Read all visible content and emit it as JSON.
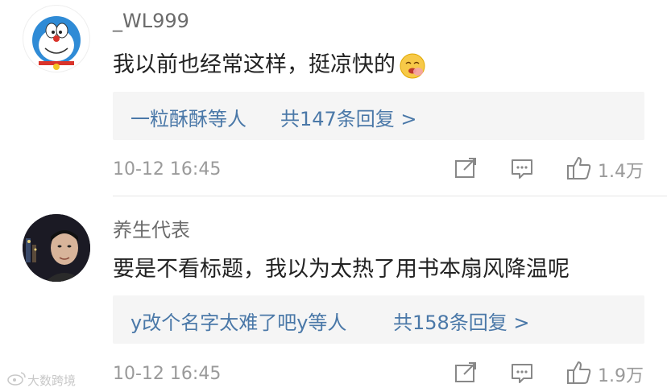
{
  "comments": [
    {
      "username": "_WL999",
      "text": "我以前也经常这样，挺凉快的",
      "reply_users": "一粒酥酥等人",
      "reply_count": "共147条回复 >",
      "time": "10-12 16:45",
      "likes": "1.4万"
    },
    {
      "username": "养生代表",
      "text": "要是不看标题，我以为太热了用书本扇风降温呢",
      "reply_users": "y改个名字太难了吧y等人",
      "reply_count": "共158条回复 >",
      "time": "10-12 16:45",
      "likes": "1.9万"
    }
  ],
  "watermark": "大数跨境",
  "colors": {
    "link": "#4a78a8",
    "muted": "#9a9a9a",
    "reply_bg": "#f5f5f5"
  },
  "icons": [
    "share-icon",
    "comment-icon",
    "like-icon",
    "emoji-icon",
    "weibo-logo-icon"
  ]
}
